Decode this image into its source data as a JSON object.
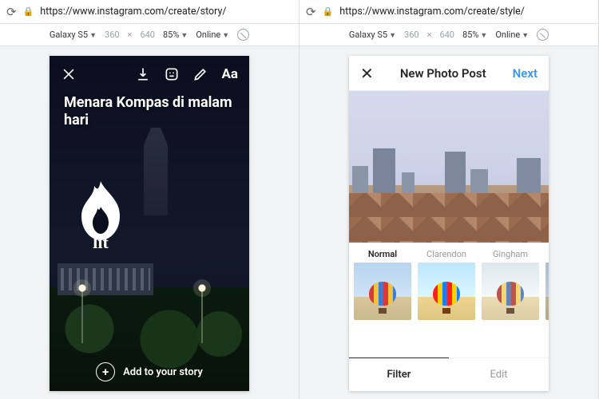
{
  "left": {
    "url": "https://www.instagram.com/create/story/",
    "devtools": {
      "device": "Galaxy S5",
      "width": "360",
      "height": "640",
      "zoom": "85%",
      "throttle": "Online"
    },
    "caption": "Menara Kompas di malam hari",
    "add_label": "Add to your story",
    "tool_text": "Aa"
  },
  "right": {
    "url": "https://www.instagram.com/create/style/",
    "devtools": {
      "device": "Galaxy S5",
      "width": "360",
      "height": "640",
      "zoom": "85%",
      "throttle": "Online"
    },
    "header": {
      "title": "New Photo Post",
      "next": "Next"
    },
    "filters": [
      {
        "name": "Normal",
        "active": true
      },
      {
        "name": "Clarendon",
        "active": false
      },
      {
        "name": "Gingham",
        "active": false
      }
    ],
    "tabs": {
      "filter": "Filter",
      "edit": "Edit"
    }
  }
}
